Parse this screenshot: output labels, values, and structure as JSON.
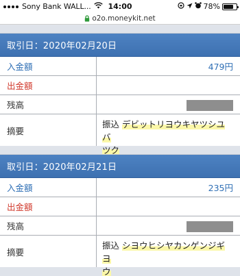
{
  "status_bar": {
    "carrier": "Sony Bank WALL...",
    "time": "14:00",
    "battery_percent": "78%",
    "battery_level": 0.78
  },
  "url_bar": {
    "url": "o2o.moneykit.net"
  },
  "transactions": [
    {
      "header": "取引日：2020年02月20日",
      "deposit_label": "入金額",
      "deposit_value": "479円",
      "withdrawal_label": "出金額",
      "withdrawal_value": "",
      "balance_label": "残高",
      "memo_label": "摘要",
      "memo_type": "振込",
      "memo_line1": "デビットリヨウキヤツシユバ",
      "memo_line2": "ツク"
    },
    {
      "header": "取引日：2020年02月21日",
      "deposit_label": "入金額",
      "deposit_value": "235円",
      "withdrawal_label": "出金額",
      "withdrawal_value": "",
      "balance_label": "残高",
      "memo_label": "摘要",
      "memo_type": "振込",
      "memo_line1": "シヨウヒシヤカンゲンジギヨ",
      "memo_line2": "ウ"
    }
  ]
}
